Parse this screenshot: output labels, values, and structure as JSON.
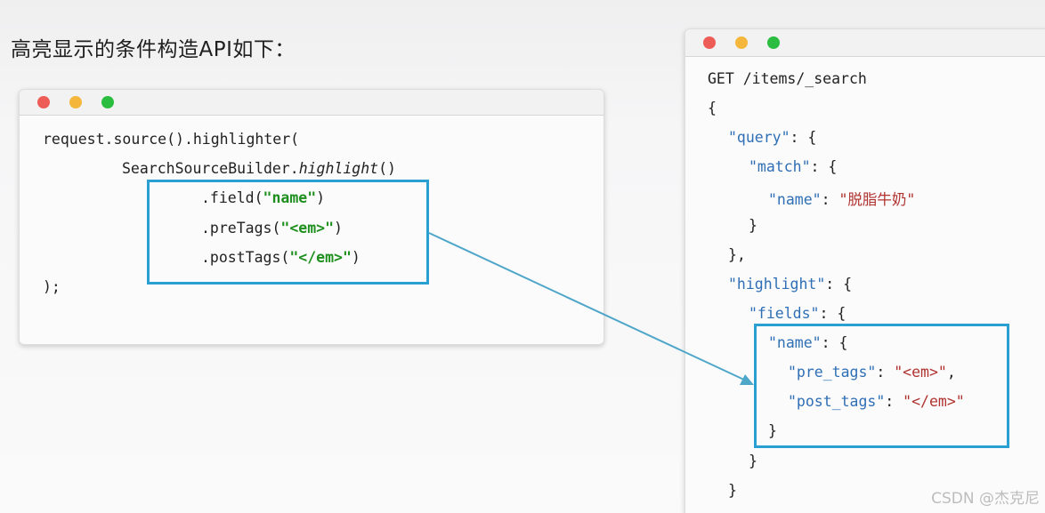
{
  "heading": "高亮显示的条件构造API如下：",
  "java_code": {
    "l1": "request.source().highlighter(",
    "l2_prefix": "SearchSourceBuilder.",
    "l2_method": "highlight",
    "l2_suffix": "()",
    "l3_prefix": ".field(",
    "l3_str": "\"name\"",
    "l3_suffix": ")",
    "l4_prefix": ".preTags(",
    "l4_str": "\"<em>\"",
    "l4_suffix": ")",
    "l5_prefix": ".postTags(",
    "l5_str": "\"</em>\"",
    "l5_suffix": ")",
    "l6": ");"
  },
  "json_code": {
    "l1": "GET /items/_search",
    "l2": "{",
    "query_key": "\"query\"",
    "query_rest": ": {",
    "match_key": "\"match\"",
    "match_rest": ": {",
    "name_key": "\"name\"",
    "name_sep": ": ",
    "name_val": "\"脱脂牛奶\"",
    "close_match": "}",
    "close_query": "},",
    "highlight_key": "\"highlight\"",
    "highlight_rest": ": {",
    "fields_key": "\"fields\"",
    "fields_rest": ": {",
    "hname_key": "\"name\"",
    "hname_rest": ": {",
    "pre_key": "\"pre_tags\"",
    "pre_sep": ": ",
    "pre_val": "\"<em>\"",
    "pre_comma": ",",
    "post_key": "\"post_tags\"",
    "post_sep": ": ",
    "post_val": "\"</em>\"",
    "close_hname": "}",
    "close_fields": "}",
    "close_highlight": "}"
  },
  "watermark": "CSDN @杰克尼",
  "colors": {
    "highlight_box": "#2a9fd2",
    "string_green": "#1d8f1d",
    "json_key": "#2f6fb5",
    "json_value": "#b0322f"
  }
}
